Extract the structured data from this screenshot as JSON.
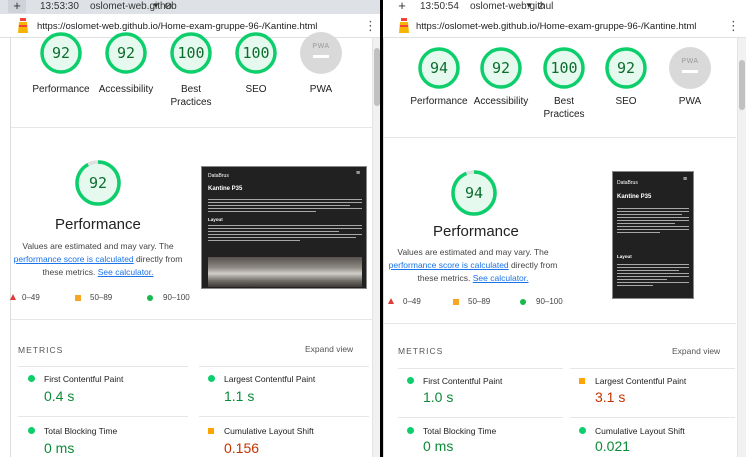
{
  "left": {
    "tab": {
      "time": "13:53:30",
      "site": "oslomet-web.github"
    },
    "url": "https://oslomet-web.github.io/Home-exam-gruppe-96-/Kantine.html",
    "gauges": [
      {
        "label": "Performance",
        "value": "92"
      },
      {
        "label": "Accessibility",
        "value": "92"
      },
      {
        "label": "Best Practices",
        "value": "100"
      },
      {
        "label": "SEO",
        "value": "100"
      },
      {
        "label": "PWA",
        "value": "PWA"
      }
    ],
    "big_score": "92",
    "category_title": "Performance",
    "desc_1": "Values are estimated and may vary. The",
    "desc_link": "performance score is calculated",
    "desc_2": "directly from these metrics.",
    "desc_link2": "See calculator.",
    "legend": {
      "fail": "0–49",
      "average": "50–89",
      "pass": "90–100"
    },
    "screenshot": {
      "brand": "DataBrus",
      "title": "Kantine P35",
      "layout_label": "Layout"
    },
    "metrics_heading": "METRICS",
    "expand_label": "Expand view",
    "metrics": [
      {
        "name": "First Contentful Paint",
        "value": "0.4 s",
        "rating": "pass"
      },
      {
        "name": "Largest Contentful Paint",
        "value": "1.1 s",
        "rating": "pass"
      },
      {
        "name": "Total Blocking Time",
        "value": "0 ms",
        "rating": "pass"
      },
      {
        "name": "Cumulative Layout Shift",
        "value": "0.156",
        "rating": "average"
      }
    ]
  },
  "right": {
    "tab": {
      "time": "13:50:54",
      "site": "oslomet-web.githul"
    },
    "url": "https://oslomet-web.github.io/Home-exam-gruppe-96-/Kantine.html",
    "gauges": [
      {
        "label": "Performance",
        "value": "94"
      },
      {
        "label": "Accessibility",
        "value": "92"
      },
      {
        "label": "Best Practices",
        "value": "100"
      },
      {
        "label": "SEO",
        "value": "92"
      },
      {
        "label": "PWA",
        "value": "PWA"
      }
    ],
    "big_score": "94",
    "category_title": "Performance",
    "desc_1": "Values are estimated and may vary. The",
    "desc_link": "performance score is calculated",
    "desc_2": "directly from these metrics.",
    "desc_link2": "See calculator.",
    "legend": {
      "fail": "0–49",
      "average": "50–89",
      "pass": "90–100"
    },
    "screenshot": {
      "brand": "DataBrus",
      "title": "Kantine P35",
      "layout_label": "Layout"
    },
    "metrics_heading": "METRICS",
    "expand_label": "Expand view",
    "metrics": [
      {
        "name": "First Contentful Paint",
        "value": "1.0 s",
        "rating": "pass"
      },
      {
        "name": "Largest Contentful Paint",
        "value": "3.1 s",
        "rating": "average"
      },
      {
        "name": "Total Blocking Time",
        "value": "0 ms",
        "rating": "pass"
      },
      {
        "name": "Cumulative Layout Shift",
        "value": "0.021",
        "rating": "pass"
      }
    ]
  },
  "colors": {
    "pass": "#0cce6b",
    "average": "#ffa400",
    "fail": "#ff4e42",
    "pwa": "#cccccc"
  },
  "icons": [
    "plus-icon",
    "chevron-down-icon",
    "ban-icon",
    "lighthouse-favicon-icon",
    "kebab-menu-icon",
    "hamburger-icon"
  ]
}
